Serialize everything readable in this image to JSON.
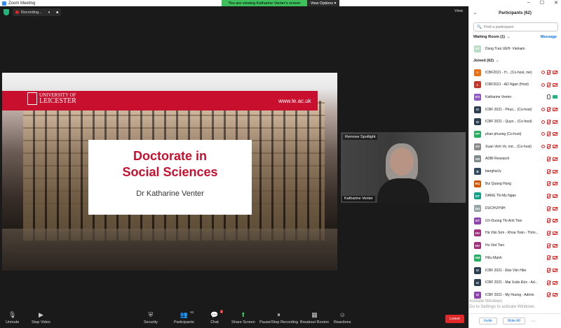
{
  "window": {
    "title": "Zoom Meeting",
    "controls": [
      "–",
      "☐",
      "✕"
    ]
  },
  "topbar": {
    "recording_label": "Recording...",
    "pause_icon": "⏸",
    "stop_icon": "■",
    "banner_text": "You are viewing Katharine Venter's screen",
    "view_options": "View Options ▾",
    "view_label": "View"
  },
  "slide": {
    "university_line1": "UNIVERSITY OF",
    "university_line2": "LEICESTER",
    "url": "www.le.ac.uk",
    "title_line1": "Doctorate in",
    "title_line2": "Social Sciences",
    "presenter": "Dr Katharine Venter"
  },
  "video": {
    "spotlight_action": "Remove Spotlight",
    "participant_name": "Katharine Venter"
  },
  "toolbar": {
    "unmute": "Unmute",
    "stop_video": "Stop Video",
    "security": "Security",
    "participants": "Participants",
    "participants_count": "63",
    "chat": "Chat",
    "chat_badge": "2",
    "share_screen": "Share Screen",
    "record": "Pause/Stop Recording",
    "breakout": "Breakout Rooms",
    "reactions": "Reactions",
    "leave": "Leave"
  },
  "panel": {
    "title": "Participants (62)",
    "search_placeholder": "Find a participant",
    "waiting_room_label": "Waiting Room (1)",
    "message_label": "Message",
    "waiting": [
      {
        "initials": "DT",
        "color": "#b8dcc4",
        "name": "Dong Tran UEH- Vietnam"
      }
    ],
    "joined_label": "Joined (62)",
    "joined": [
      {
        "initials": "I-",
        "color": "#e8701a",
        "name": "ICBF2021 - H...  (Co-host, me)",
        "mic": "muted",
        "cam": "off",
        "rec": true
      },
      {
        "initials": "I-",
        "color": "#c0392b",
        "name": "ICBF2021 - AD Ngan (Host)",
        "mic": "muted",
        "cam": "off",
        "rec": true
      },
      {
        "initials": "KV",
        "color": "#8e5cc2",
        "name": "Katharine Venter",
        "mic": "on",
        "cam": "on",
        "rec": false
      },
      {
        "initials": "I2",
        "color": "#2c3e50",
        "name": "ICBF 2021 - Phuo...  (Co-host)",
        "mic": "muted",
        "cam": "off",
        "rec": true
      },
      {
        "initials": "I2",
        "color": "#2c3e50",
        "name": "ICBF 2021 - Quyn...  (Co-host)",
        "mic": "muted",
        "cam": "off",
        "rec": true
      },
      {
        "initials": "PP",
        "color": "#27ae60",
        "name": "phan phuong (Co-host)",
        "mic": "muted",
        "cam": "off",
        "rec": true
      },
      {
        "initials": "XV",
        "color": "#8a8a8a",
        "name": "Xuan Vinh Vo, irst...  (Co-host)",
        "mic": "muted",
        "cam": "off",
        "rec": true
      },
      {
        "initials": "AR",
        "color": "#7f8c8d",
        "name": "ADBI Research",
        "mic": "muted",
        "cam": "off",
        "rec": false
      },
      {
        "initials": "B",
        "color": "#34495e",
        "name": "banghai.ly",
        "mic": "muted",
        "cam": "off",
        "rec": false
      },
      {
        "initials": "BQ",
        "color": "#d35400",
        "name": "Bui Quang Hung",
        "mic": "muted",
        "cam": "off",
        "rec": false
      },
      {
        "initials": "DT",
        "color": "#16a085",
        "name": "DANG Thi My Ngan",
        "mic": "muted",
        "cam": "off",
        "rec": false
      },
      {
        "initials": "DU",
        "color": "#95a5a6",
        "name": "DUCHUYNH",
        "mic": "muted",
        "cam": "off",
        "rec": false
      },
      {
        "initials": "GT",
        "color": "#8e44ad",
        "name": "GV-Duong Thi Anh Tien",
        "mic": "muted",
        "cam": "off",
        "rec": false
      },
      {
        "initials": "HV",
        "color": "#a1317a",
        "name": "Hà Văn Sơn - Khoa Toán - Thốn...",
        "mic": "muted",
        "cam": "off",
        "rec": false
      },
      {
        "initials": "HV",
        "color": "#a1317a",
        "name": "Ho Viet Tien",
        "mic": "muted",
        "cam": "off",
        "rec": false
      },
      {
        "initials": "HM",
        "color": "#27ae60",
        "name": "Hữu Mạnh",
        "mic": "muted",
        "cam": "off",
        "rec": false
      },
      {
        "initials": "I2",
        "color": "#2c3e50",
        "name": "ICBF 2021 - Đào Văn Hân",
        "mic": "muted",
        "cam": "off",
        "rec": false
      },
      {
        "initials": "I2",
        "color": "#2c3e50",
        "name": "ICBF 2021 - Mai Xuân Đức - Ad...",
        "mic": "muted",
        "cam": "off",
        "rec": false
      },
      {
        "initials": "I2",
        "color": "#8e44ad",
        "name": "ICBF 2021 - My Huong - Admin",
        "mic": "muted",
        "cam": "off",
        "rec": false
      }
    ],
    "invite": "Invite",
    "mute_all": "Mute All",
    "more": "···",
    "watermark_line1": "Activate Windows",
    "watermark_line2": "Go to Settings to activate Windows."
  }
}
